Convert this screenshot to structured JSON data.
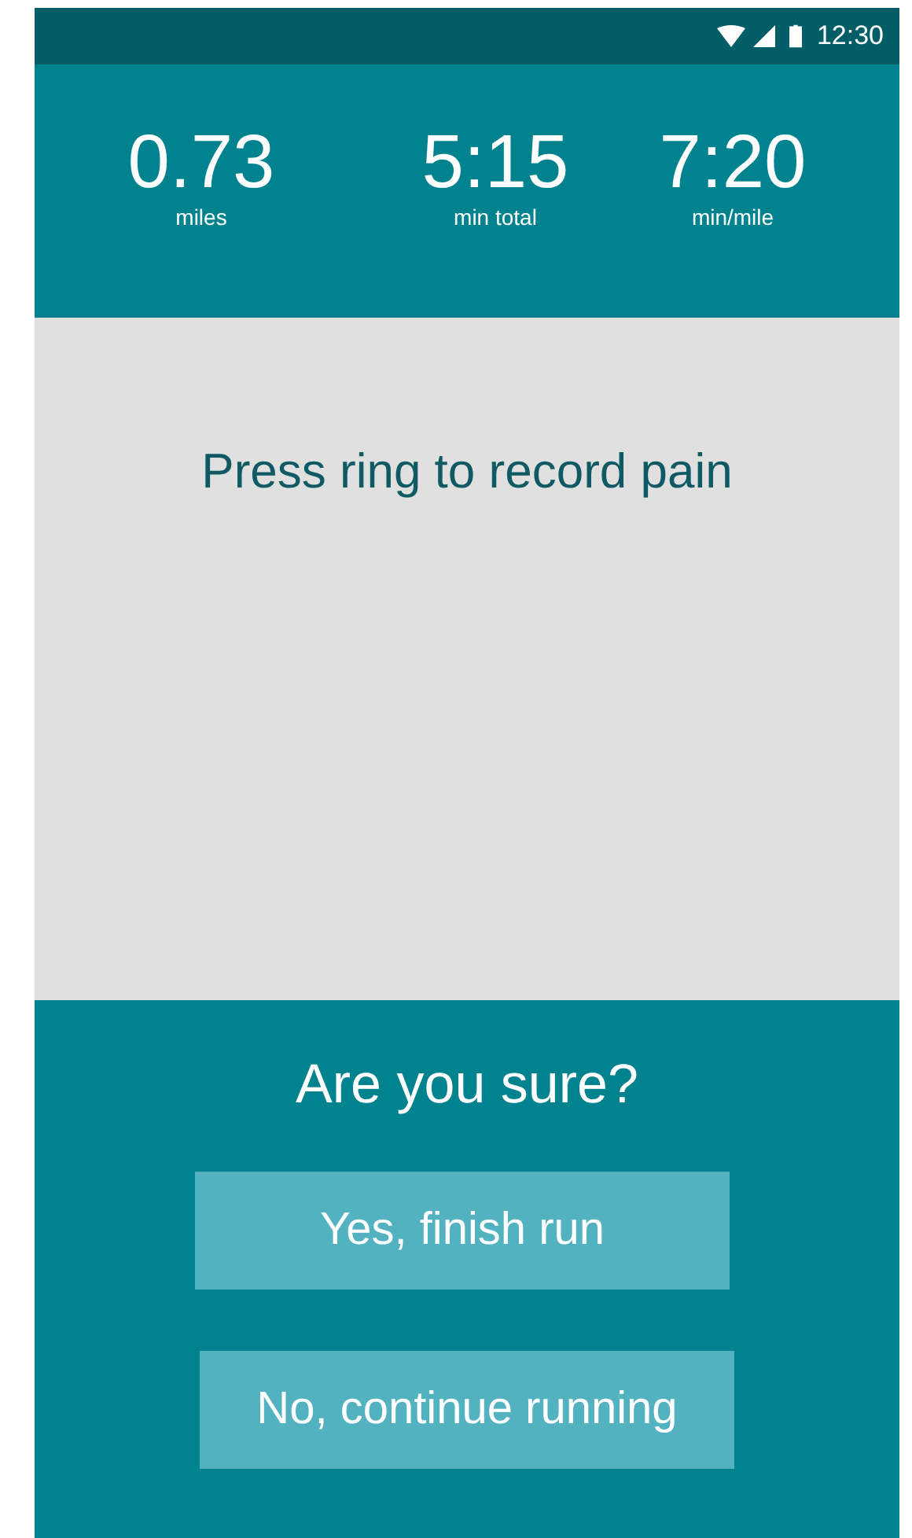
{
  "status_bar": {
    "time": "12:30"
  },
  "stats": [
    {
      "value": "0.73",
      "label": "miles"
    },
    {
      "value": "5:15",
      "label": "min total"
    },
    {
      "value": "7:20",
      "label": "min/mile"
    }
  ],
  "prompt": "Press ring to record pain",
  "confirm": {
    "question": "Are you sure?",
    "buttons": [
      "Yes, finish run",
      "No, continue running"
    ]
  }
}
